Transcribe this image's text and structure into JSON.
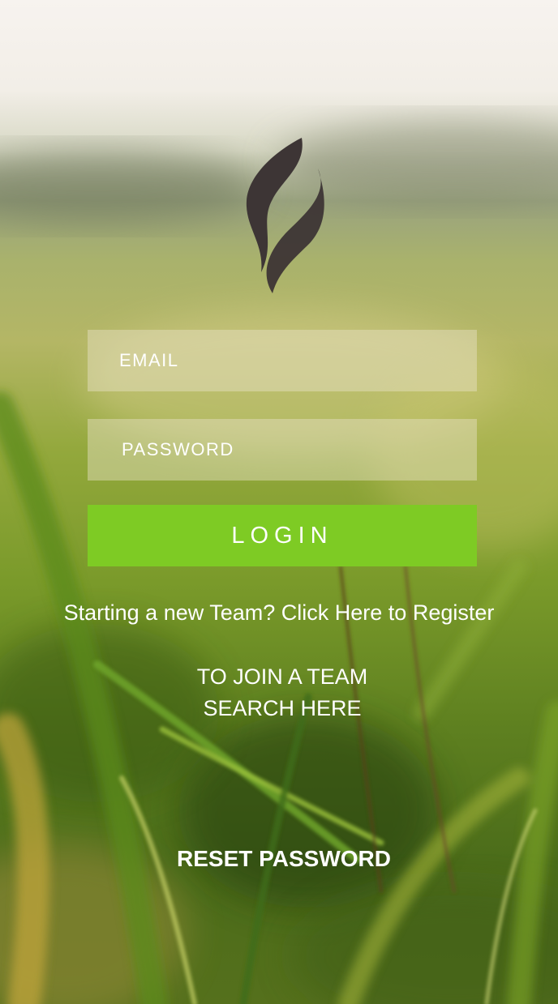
{
  "login_form": {
    "email_placeholder": "EMAIL",
    "password_placeholder": "PASSWORD",
    "login_label": "LOGIN"
  },
  "links": {
    "register": "Starting a new Team? Click Here to Register",
    "join_team_line1": "TO JOIN A TEAM",
    "join_team_line2": "SEARCH HERE",
    "reset_password": "RESET PASSWORD"
  },
  "icons": {
    "logo": "flame-logo-icon"
  },
  "colors": {
    "accent": "#7ecb24",
    "logo": "#3d3535",
    "text": "#ffffff"
  }
}
